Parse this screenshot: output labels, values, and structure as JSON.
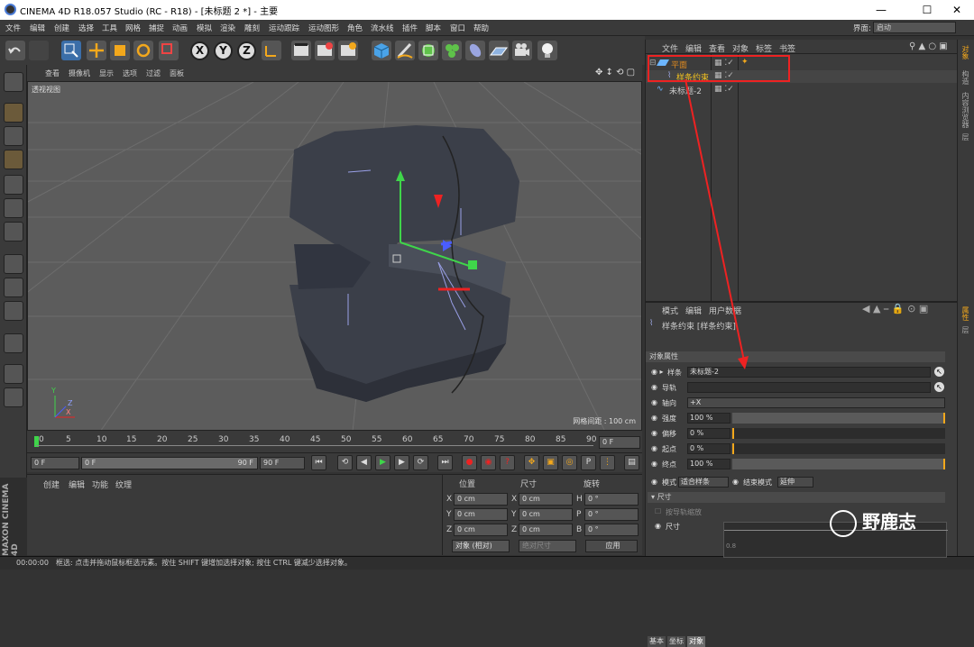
{
  "window": {
    "title": "CINEMA 4D R18.057 Studio (RC - R18) - [未标题 2 *] - 主要",
    "minimize": "—",
    "maximize": "☐",
    "close": "✕"
  },
  "menu": [
    "文件",
    "编辑",
    "创建",
    "选择",
    "工具",
    "网格",
    "捕捉",
    "动画",
    "模拟",
    "渲染",
    "雕刻",
    "运动跟踪",
    "运动图形",
    "角色",
    "流水线",
    "插件",
    "脚本",
    "窗口",
    "帮助"
  ],
  "interface": {
    "label": "界面:",
    "value": "启动"
  },
  "toolbar": {
    "x": "X",
    "y": "Y",
    "z": "Z"
  },
  "viewport": {
    "menu": [
      "查看",
      "摄像机",
      "显示",
      "选项",
      "过滤",
      "面板"
    ],
    "title": "透视视图",
    "grid_label": "网格间距 : 100 cm",
    "axis_x": "X",
    "axis_y": "Y",
    "axis_z": "Z"
  },
  "timeline": {
    "ticks": [
      "0",
      "5",
      "10",
      "15",
      "20",
      "25",
      "30",
      "35",
      "40",
      "45",
      "50",
      "55",
      "60",
      "65",
      "70",
      "75",
      "80",
      "85",
      "90"
    ],
    "current": "0 F"
  },
  "transport": {
    "start": "0 F",
    "range_start": "0 F",
    "range_end": "90 F",
    "end": "90 F"
  },
  "material": {
    "menu": [
      "创建",
      "编辑",
      "功能",
      "纹理"
    ]
  },
  "coords": {
    "headers": [
      "位置",
      "尺寸",
      "旋转"
    ],
    "rows": [
      {
        "a": "X",
        "av": "0 cm",
        "b": "X",
        "bv": "0 cm",
        "c": "H",
        "cv": "0 °"
      },
      {
        "a": "Y",
        "av": "0 cm",
        "b": "Y",
        "bv": "0 cm",
        "c": "P",
        "cv": "0 °"
      },
      {
        "a": "Z",
        "av": "0 cm",
        "b": "Z",
        "bv": "0 cm",
        "c": "B",
        "cv": "0 °"
      }
    ],
    "mode": "对象 (相对)",
    "size_mode": "绝对尺寸",
    "apply": "应用"
  },
  "status": {
    "time": "00:00:00",
    "text": "框选: 点击并拖动鼠标框选元素。按住 SHIFT 键增加选择对象; 按住 CTRL 键减少选择对象。"
  },
  "objects": {
    "menu": [
      "文件",
      "编辑",
      "查看",
      "对象",
      "标签",
      "书签"
    ],
    "items": [
      {
        "name": "平面",
        "color": "#e08a1e"
      },
      {
        "name": "样条约束",
        "color": "#f0c020"
      },
      {
        "name": "未标题-2",
        "color": "#cccccc"
      }
    ]
  },
  "attributes": {
    "menu": [
      "模式",
      "编辑",
      "用户数据"
    ],
    "title": "样条约束 [样条约束]",
    "tabs": [
      "基本",
      "坐标",
      "对象"
    ],
    "section": "对象属性",
    "rows": [
      {
        "label": "样条",
        "value": "未标题-2"
      },
      {
        "label": "导轨",
        "value": ""
      },
      {
        "label": "轴向",
        "value": "+X"
      },
      {
        "label": "强度",
        "value": "100 %"
      },
      {
        "label": "偏移",
        "value": "0 %"
      },
      {
        "label": "起点",
        "value": "0 %"
      },
      {
        "label": "终点",
        "value": "100 %"
      }
    ],
    "mode_label": "模式",
    "mode_value": "适合样条",
    "end_label": "结束模式",
    "end_value": "延伸",
    "size_section": "尺寸",
    "size_check": "按导轨缩放",
    "size_label": "尺寸",
    "graph_value": "0.8"
  },
  "righttabs": [
    "对象",
    "构造",
    "内容浏览器",
    "层"
  ],
  "attr_side": [
    "属性",
    "层"
  ],
  "watermark": "野鹿志",
  "brand": "MAXON CINEMA 4D"
}
